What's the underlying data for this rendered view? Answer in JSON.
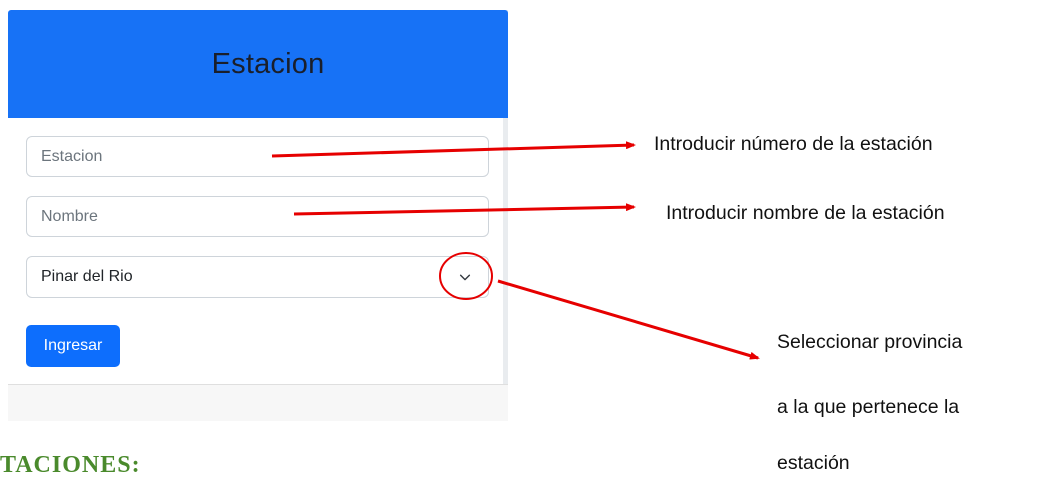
{
  "card": {
    "title": "Estacion",
    "header_color": "#1772f6",
    "fields": {
      "estacion_placeholder": "Estacion",
      "nombre_placeholder": "Nombre"
    },
    "province_select": {
      "selected": "Pinar del Rio",
      "icon": "chevron-down-icon"
    },
    "submit_label": "Ingresar",
    "button_color": "#0d6efd"
  },
  "annotations": {
    "station_number": "Introducir número de la estación",
    "station_name": "Introducir nombre de la estación",
    "province_line1": "Seleccionar provincia",
    "province_line2": "a la que pertenece la",
    "province_line3": "estación",
    "arrow_color": "#e60000"
  },
  "document": {
    "cut_heading": "TACIONES:",
    "heading_color": "#4a8a2c"
  }
}
